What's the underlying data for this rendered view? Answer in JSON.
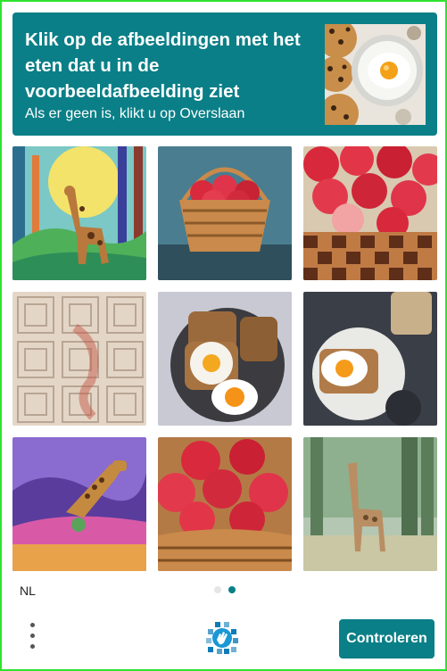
{
  "header": {
    "title": "Klik op de afbeeldingen met het eten dat u in de voorbeeldafbeelding ziet",
    "subtitle": "Als er geen is, klikt u op Overslaan"
  },
  "grid": {
    "tiles": [
      {
        "content": "giraffe-forest-painting"
      },
      {
        "content": "apple-basket-small"
      },
      {
        "content": "apple-basket-checkered"
      },
      {
        "content": "distorted-pattern"
      },
      {
        "content": "egg-toast-plate"
      },
      {
        "content": "egg-toast-dark-plate"
      },
      {
        "content": "giraffe-purple-field"
      },
      {
        "content": "apple-basket-closeup"
      },
      {
        "content": "giraffe-blurry-forest"
      }
    ]
  },
  "footer": {
    "language": "NL",
    "verify_label": "Controleren",
    "pages_total": 2,
    "active_page": 2
  },
  "colors": {
    "accent": "#0a7f87",
    "frame": "#2ee32e"
  }
}
